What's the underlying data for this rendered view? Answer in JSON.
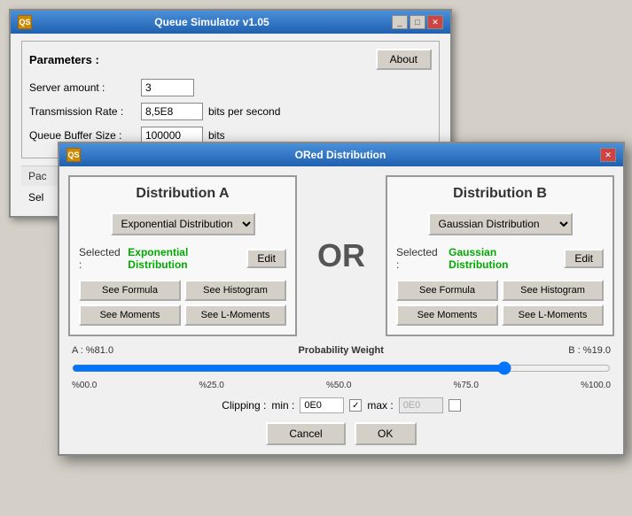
{
  "mainWindow": {
    "title": "Queue Simulator v1.05",
    "icon": "QS",
    "params": {
      "label": "Parameters :",
      "aboutBtn": "About",
      "fields": [
        {
          "label": "Server amount :",
          "value": "3",
          "unit": ""
        },
        {
          "label": "Transmission Rate :",
          "value": "8,5E8",
          "unit": "bits per second"
        },
        {
          "label": "Queue Buffer Size :",
          "value": "100000",
          "unit": "bits"
        }
      ]
    },
    "partial": {
      "label": "Pac"
    },
    "selectLabel": "Sel"
  },
  "modal": {
    "title": "ORed Distribution",
    "distA": {
      "title": "Distribution A",
      "dropdownValue": "Exponential Distribution",
      "selectedLabel": "Selected :",
      "selectedValue": "Exponential Distribution",
      "editBtn": "Edit",
      "formulaBtn": "See Formula",
      "histogramBtn": "See Histogram",
      "momentsBtn": "See Moments",
      "lmomentsBtn": "See L-Moments"
    },
    "orLabel": "OR",
    "distB": {
      "title": "Distribution B",
      "dropdownValue": "Gaussian Distribution",
      "selectedLabel": "Selected :",
      "selectedValue": "Gaussian Distribution",
      "editBtn": "Edit",
      "formulaBtn": "See Formula",
      "histogramBtn": "See Histogram",
      "momentsBtn": "See Moments",
      "lmomentsBtn": "See L-Moments"
    },
    "probWeight": {
      "label": "Probability Weight",
      "aLabel": "A : %81.0",
      "bLabel": "B : %19.0",
      "sliderValue": 81,
      "ticks": [
        "%00.0",
        "%25.0",
        "%50.0",
        "%75.0",
        "%100.0"
      ]
    },
    "clipping": {
      "label": "Clipping :",
      "minLabel": "min :",
      "minValue": "0E0",
      "maxLabel": "max :",
      "maxValue": "0E0",
      "checkboxChecked": true
    },
    "cancelBtn": "Cancel",
    "okBtn": "OK"
  }
}
